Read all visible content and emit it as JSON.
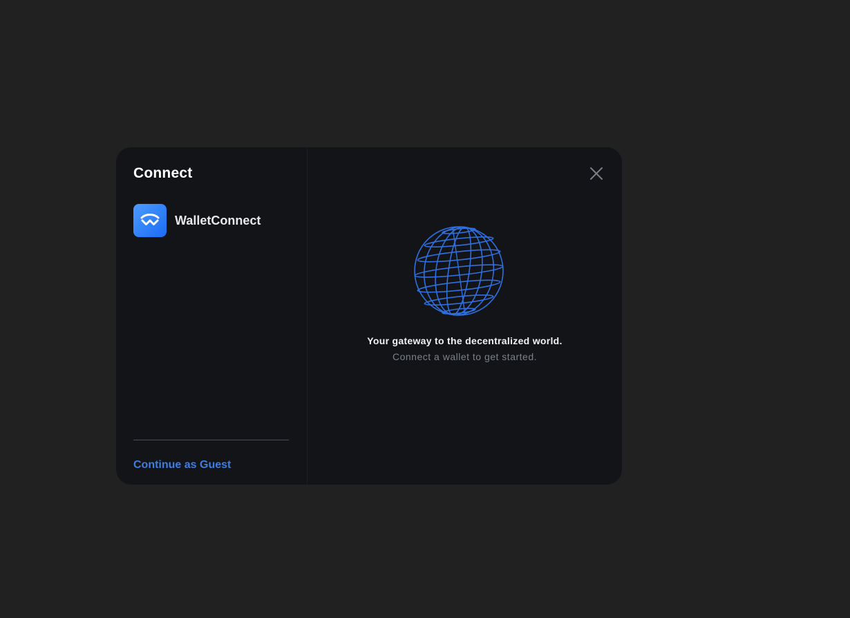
{
  "modal": {
    "title": "Connect",
    "wallets": [
      {
        "label": "WalletConnect",
        "icon": "walletconnect-icon"
      }
    ],
    "guest_link": "Continue as Guest",
    "close_icon": "close-icon",
    "hero_icon": "globe-icon",
    "tagline": "Your gateway to the decentralized world.",
    "subtagline": "Connect a wallet to get started."
  },
  "colors": {
    "backdrop": "#212121",
    "modal_bg": "#131418",
    "accent": "#3d7ee0",
    "wallet_logo": "#2b7bf8",
    "globe_stroke": "#2f6fe0"
  }
}
